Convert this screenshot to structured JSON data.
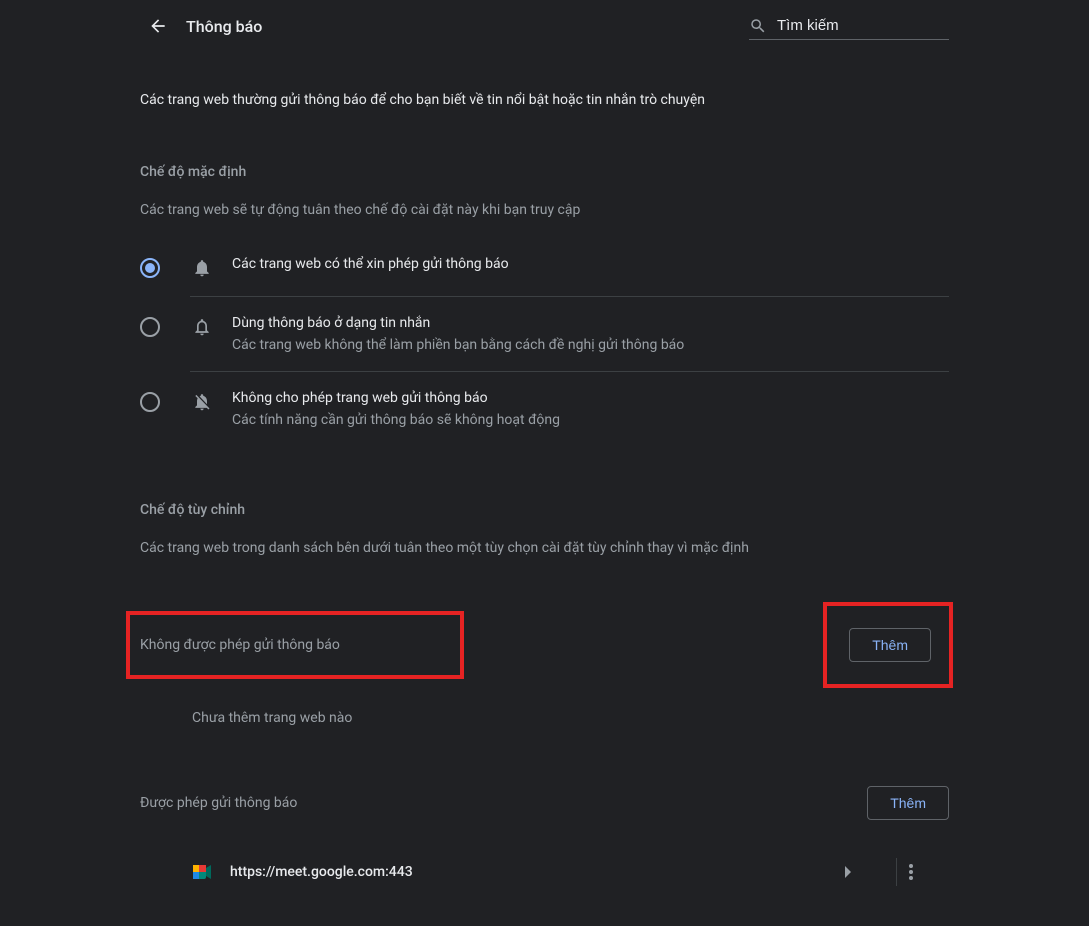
{
  "header": {
    "title": "Thông báo",
    "search_placeholder": "Tìm kiếm"
  },
  "intro": "Các trang web thường gửi thông báo để cho bạn biết về tin nổi bật hoặc tin nhắn trò chuyện",
  "default_section": {
    "heading": "Chế độ mặc định",
    "sub": "Các trang web sẽ tự động tuân theo chế độ cài đặt này khi bạn truy cập",
    "options": [
      {
        "title": "Các trang web có thể xin phép gửi thông báo",
        "sub": "",
        "selected": true
      },
      {
        "title": "Dùng thông báo ở dạng tin nhắn",
        "sub": "Các trang web không thể làm phiền bạn bằng cách đề nghị gửi thông báo",
        "selected": false
      },
      {
        "title": "Không cho phép trang web gửi thông báo",
        "sub": "Các tính năng cần gửi thông báo sẽ không hoạt động",
        "selected": false
      }
    ]
  },
  "custom_section": {
    "heading": "Chế độ tùy chỉnh",
    "sub": "Các trang web trong danh sách bên dưới tuân theo một tùy chọn cài đặt tùy chỉnh thay vì mặc định",
    "block": {
      "label": "Không được phép gửi thông báo",
      "add_btn": "Thêm",
      "empty": "Chưa thêm trang web nào"
    },
    "allow": {
      "label": "Được phép gửi thông báo",
      "add_btn": "Thêm",
      "sites": [
        {
          "url": "https://meet.google.com:443"
        }
      ]
    }
  }
}
